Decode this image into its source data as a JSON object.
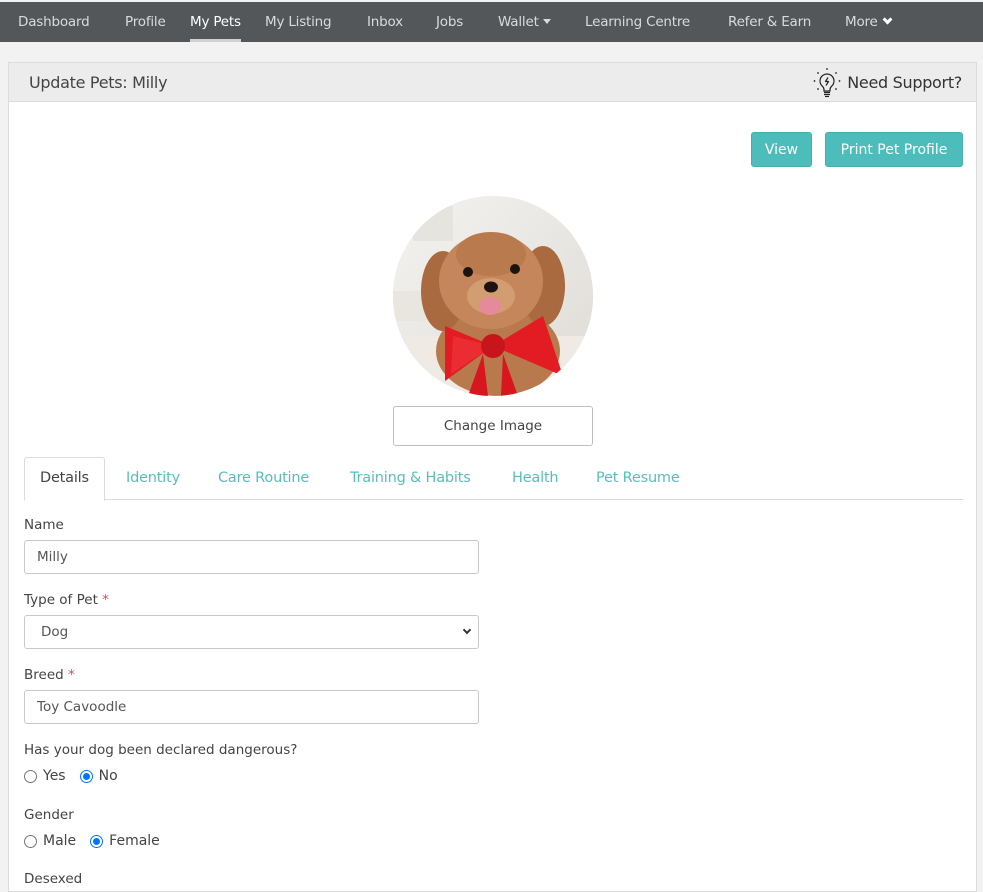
{
  "nav": {
    "items": [
      {
        "label": "Dashboard",
        "active": false
      },
      {
        "label": "Profile",
        "active": false
      },
      {
        "label": "My Pets",
        "active": true
      },
      {
        "label": "My Listing",
        "active": false
      },
      {
        "label": "Inbox",
        "active": false
      },
      {
        "label": "Jobs",
        "active": false
      },
      {
        "label": "Wallet",
        "active": false,
        "icon": "caret-down-icon"
      },
      {
        "label": "Learning Centre",
        "active": false
      },
      {
        "label": "Refer & Earn",
        "active": false
      },
      {
        "label": "More",
        "active": false,
        "icon": "chevron-down-icon"
      }
    ]
  },
  "header": {
    "title": "Update Pets: Milly",
    "support_label": "Need Support?",
    "support_icon": "lightbulb-icon"
  },
  "actions": {
    "view_label": "View",
    "print_label": "Print Pet Profile"
  },
  "pet_image": {
    "alt": "Milly",
    "change_label": "Change Image"
  },
  "tabs": [
    {
      "label": "Details",
      "active": true
    },
    {
      "label": "Identity",
      "active": false
    },
    {
      "label": "Care Routine",
      "active": false
    },
    {
      "label": "Training & Habits",
      "active": false
    },
    {
      "label": "Health",
      "active": false
    },
    {
      "label": "Pet Resume",
      "active": false
    }
  ],
  "form": {
    "name": {
      "label": "Name",
      "value": "Milly"
    },
    "type": {
      "label": "Type of Pet",
      "required_mark": "*",
      "value": "Dog"
    },
    "breed": {
      "label": "Breed",
      "required_mark": "*",
      "value": "Toy Cavoodle"
    },
    "dangerous": {
      "label": "Has your dog been declared dangerous?",
      "options": [
        "Yes",
        "No"
      ],
      "selected": "No"
    },
    "gender": {
      "label": "Gender",
      "options": [
        "Male",
        "Female"
      ],
      "selected": "Female"
    },
    "desexed": {
      "label": "Desexed"
    }
  },
  "colors": {
    "nav_bg": "#54575a",
    "accent": "#4dbdbb",
    "required": "#e04b4b",
    "radio_checked": "#0075ff"
  }
}
